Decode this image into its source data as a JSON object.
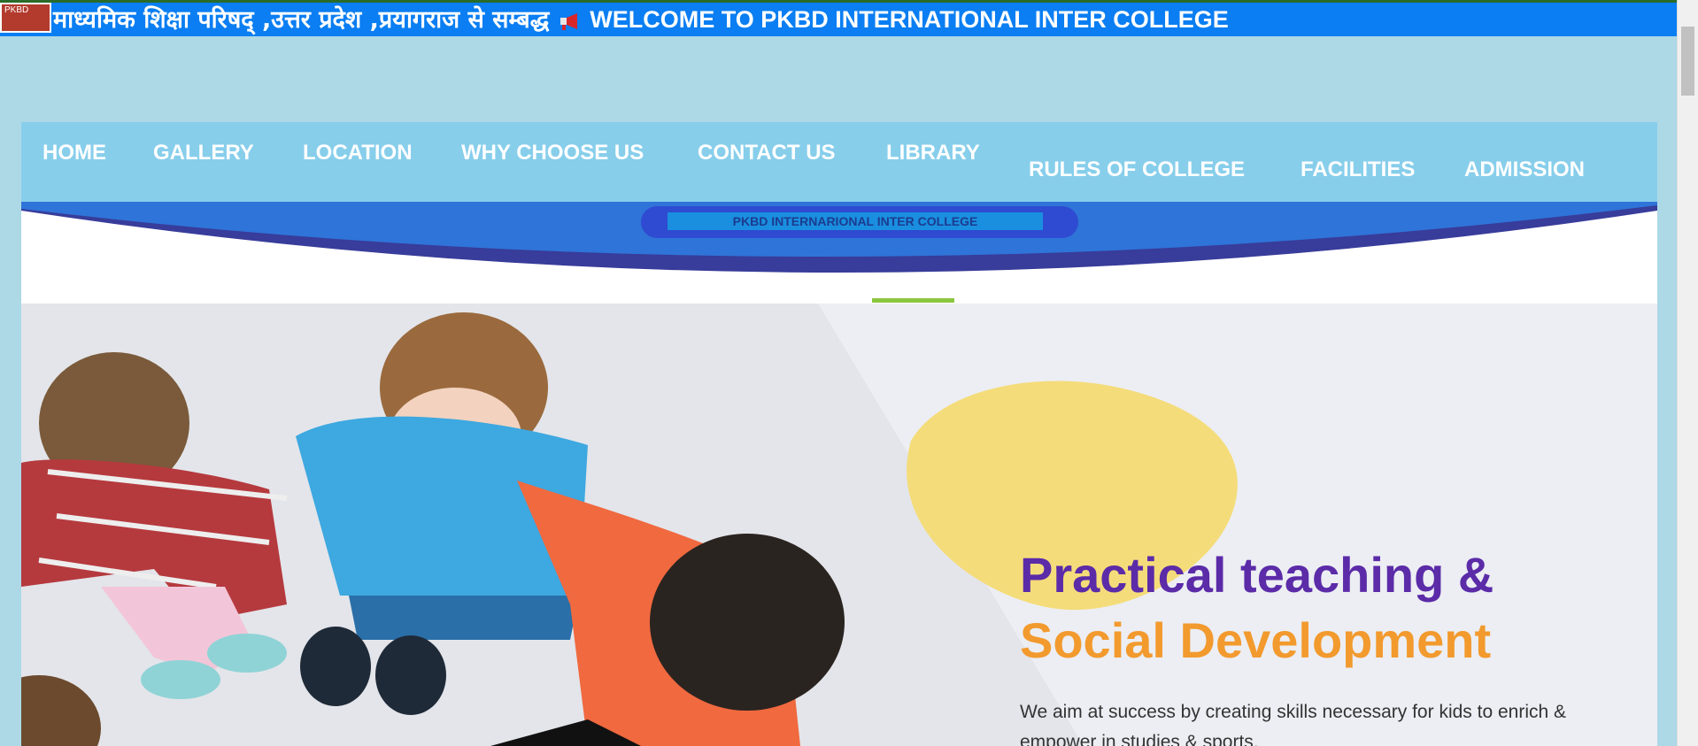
{
  "topbar": {
    "logo_text": "PKBD",
    "hindi_text": "माध्यमिक शिक्षा परिषद् ,उत्तर प्रदेश ,प्रयागराज से सम्बद्ध",
    "icon": "megaphone-icon",
    "welcome_text": "WELCOME TO PKBD INTERNATIONAL INTER COLLEGE"
  },
  "nav": {
    "items": [
      {
        "label": "HOME"
      },
      {
        "label": "GALLERY"
      },
      {
        "label": "LOCATION"
      },
      {
        "label": "WHY CHOOSE US"
      },
      {
        "label": "CONTACT US"
      },
      {
        "label": "LIBRARY"
      },
      {
        "label": "RULES OF COLLEGE"
      },
      {
        "label": "FACILITIES"
      },
      {
        "label": "ADMISSION"
      }
    ]
  },
  "banner": {
    "college_name": "PKBD INTERNARIONAL INTER COLLEGE"
  },
  "hero": {
    "title_line1": "Practical teaching &",
    "title_line2": "Social Development",
    "description": "We aim at success by creating skills necessary for kids to enrich & empower in studies & sports."
  },
  "colors": {
    "topbar": "#0a7ef2",
    "nav": "#87ceeb",
    "page_bg": "#add8e6",
    "title_purple": "#5b2ba8",
    "title_orange": "#f29a2e"
  }
}
